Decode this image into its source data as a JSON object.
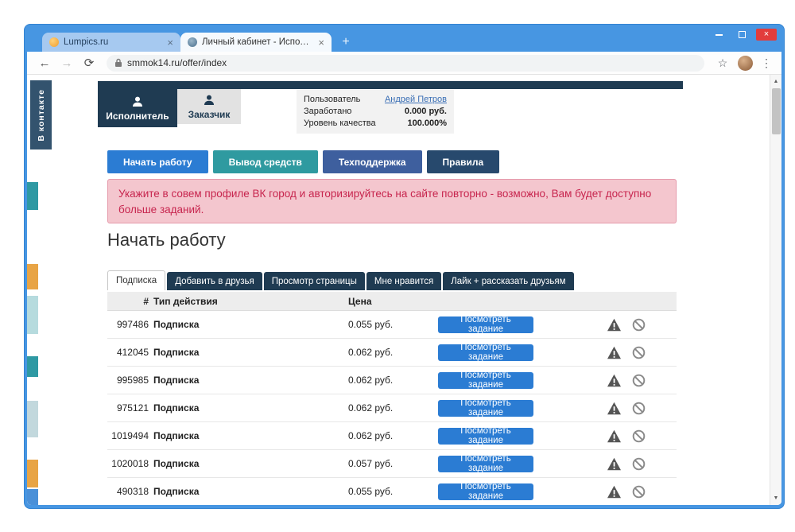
{
  "browser": {
    "tabs": [
      {
        "title": "Lumpics.ru"
      },
      {
        "title": "Личный кабинет - Исполнителя"
      }
    ],
    "url": "smmok14.ru/offer/index"
  },
  "icons": {
    "window_close": "×",
    "tab_close": "×",
    "new_tab": "+",
    "back": "←",
    "forward": "→",
    "refresh": "⟳",
    "star": "☆",
    "menu": "⋮",
    "scroll_up": "▲",
    "scroll_down": "▼"
  },
  "colors": {
    "frame_blue": "#4796e2",
    "dark_navy": "#1f3b52",
    "accent_blue": "#2b7cd3",
    "teal": "#2f9aa0",
    "slate_blue": "#3e5f9e",
    "alert_bg": "#f4c6ce",
    "alert_text": "#c7254e"
  },
  "page": {
    "vk_banner": "В контакте",
    "role_tabs": [
      {
        "label": "Исполнитель"
      },
      {
        "label": "Заказчик"
      }
    ],
    "user_info": [
      {
        "label": "Пользователь",
        "value": "Андрей Петров"
      },
      {
        "label": "Заработано",
        "value": "0.000 руб."
      },
      {
        "label": "Уровень качества",
        "value": "100.000%"
      }
    ],
    "nav_buttons": [
      {
        "label": "Начать работу"
      },
      {
        "label": "Вывод средств"
      },
      {
        "label": "Техподдержка"
      },
      {
        "label": "Правила"
      }
    ],
    "alert_text": "Укажите в совем профиле ВК город и авторизируйтесь на сайте повторно - возможно, Вам будет доступно больше заданий.",
    "heading": "Начать работу",
    "task_tabs": [
      {
        "label": "Подписка"
      },
      {
        "label": "Добавить в друзья"
      },
      {
        "label": "Просмотр страницы"
      },
      {
        "label": "Мне нравится"
      },
      {
        "label": "Лайк + рассказать друзьям"
      }
    ],
    "table": {
      "headers": {
        "id": "#",
        "type": "Тип действия",
        "price": "Цена"
      },
      "view_button": "Посмотреть задание",
      "rows": [
        {
          "id": "997486",
          "type": "Подписка",
          "price": "0.055 руб."
        },
        {
          "id": "412045",
          "type": "Подписка",
          "price": "0.062 руб."
        },
        {
          "id": "995985",
          "type": "Подписка",
          "price": "0.062 руб."
        },
        {
          "id": "975121",
          "type": "Подписка",
          "price": "0.062 руб."
        },
        {
          "id": "1019494",
          "type": "Подписка",
          "price": "0.062 руб."
        },
        {
          "id": "1020018",
          "type": "Подписка",
          "price": "0.057 руб."
        },
        {
          "id": "490318",
          "type": "Подписка",
          "price": "0.055 руб."
        }
      ]
    }
  }
}
